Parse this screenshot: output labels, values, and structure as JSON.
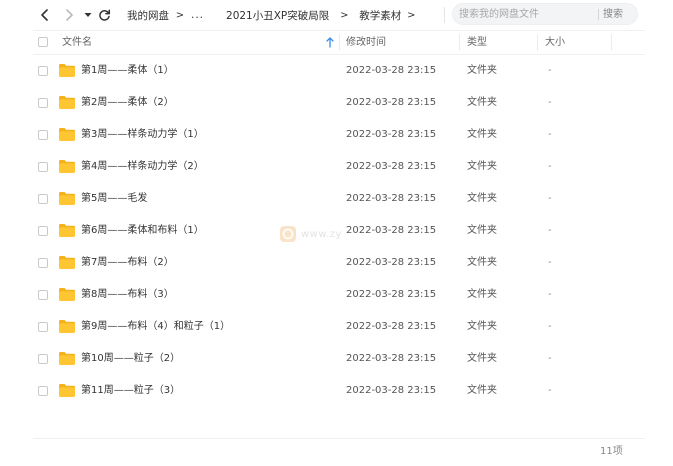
{
  "toolbar": {
    "breadcrumb": {
      "root": "我的网盘",
      "separator": ">",
      "ellipsis": "...",
      "items": [
        "2021小丑XP突破局限",
        "教学素材"
      ]
    },
    "search": {
      "placeholder": "搜索我的网盘文件",
      "button_label": "搜索"
    }
  },
  "columns": {
    "name": "文件名",
    "modified": "修改时间",
    "type": "类型",
    "size": "大小",
    "sort_column": "name",
    "sort_direction": "ascending"
  },
  "files": [
    {
      "name": "第1周——柔体（1）",
      "modified": "2022-03-28 23:15",
      "type": "文件夹",
      "size": "-"
    },
    {
      "name": "第2周——柔体（2）",
      "modified": "2022-03-28 23:15",
      "type": "文件夹",
      "size": "-"
    },
    {
      "name": "第3周——样条动力学（1）",
      "modified": "2022-03-28 23:15",
      "type": "文件夹",
      "size": "-"
    },
    {
      "name": "第4周——样条动力学（2）",
      "modified": "2022-03-28 23:15",
      "type": "文件夹",
      "size": "-"
    },
    {
      "name": "第5周——毛发",
      "modified": "2022-03-28 23:15",
      "type": "文件夹",
      "size": "-"
    },
    {
      "name": "第6周——柔体和布料（1）",
      "modified": "2022-03-28 23:15",
      "type": "文件夹",
      "size": "-"
    },
    {
      "name": "第7周——布料（2）",
      "modified": "2022-03-28 23:15",
      "type": "文件夹",
      "size": "-"
    },
    {
      "name": "第8周——布料（3）",
      "modified": "2022-03-28 23:15",
      "type": "文件夹",
      "size": "-"
    },
    {
      "name": "第9周——布料（4）和粒子（1）",
      "modified": "2022-03-28 23:15",
      "type": "文件夹",
      "size": "-"
    },
    {
      "name": "第10周——粒子（2）",
      "modified": "2022-03-28 23:15",
      "type": "文件夹",
      "size": "-"
    },
    {
      "name": "第11周——粒子（3）",
      "modified": "2022-03-28 23:15",
      "type": "文件夹",
      "size": "-"
    }
  ],
  "watermark": {
    "text": "www.zy"
  },
  "footer": {
    "item_count": "11项"
  },
  "colors": {
    "folder": "#ffc533",
    "folder_back": "#f5b119",
    "accent": "#3a8ee6",
    "text": "#333333",
    "muted": "#888888"
  },
  "icons": {
    "back": "chevron-left-icon",
    "forward": "chevron-right-icon",
    "history": "caret-down-icon",
    "refresh": "refresh-icon",
    "sort": "arrow-up-icon",
    "folder": "folder-icon"
  }
}
